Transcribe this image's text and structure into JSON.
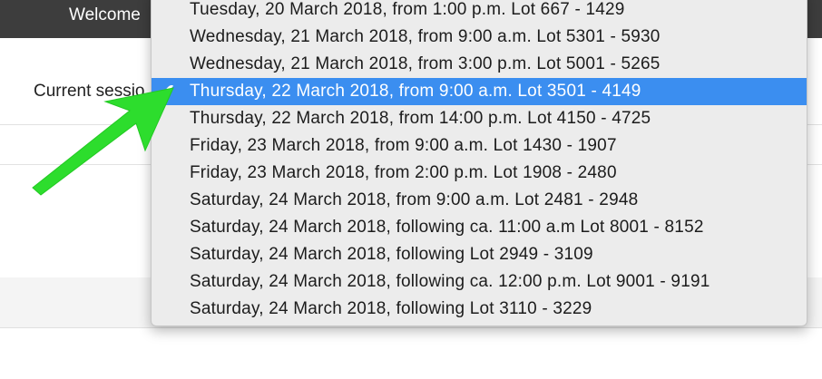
{
  "header": {
    "welcome_text": "Welcome"
  },
  "form": {
    "session_label": "Current sessio"
  },
  "dropdown": {
    "options": [
      {
        "label": "Tuesday, 20 March 2018, from 1:00 p.m. Lot 667 - 1429",
        "selected": false
      },
      {
        "label": "Wednesday, 21 March 2018, from 9:00 a.m. Lot 5301 - 5930",
        "selected": false
      },
      {
        "label": "Wednesday, 21 March 2018, from 3:00 p.m. Lot 5001 - 5265",
        "selected": false
      },
      {
        "label": "Thursday, 22 March 2018, from 9:00 a.m. Lot 3501 - 4149",
        "selected": true
      },
      {
        "label": "Thursday, 22 March 2018, from 14:00 p.m. Lot 4150 - 4725",
        "selected": false
      },
      {
        "label": "Friday, 23 March 2018, from 9:00 a.m. Lot 1430 - 1907",
        "selected": false
      },
      {
        "label": "Friday, 23 March 2018, from 2:00 p.m. Lot 1908 - 2480",
        "selected": false
      },
      {
        "label": "Saturday, 24 March 2018, from 9:00 a.m. Lot 2481 - 2948",
        "selected": false
      },
      {
        "label": "Saturday, 24 March 2018, following ca. 11:00 a.m Lot 8001 - 8152",
        "selected": false
      },
      {
        "label": "Saturday, 24 March 2018, following Lot 2949 - 3109",
        "selected": false
      },
      {
        "label": "Saturday, 24 March 2018, following ca. 12:00 p.m. Lot 9001 - 9191",
        "selected": false
      },
      {
        "label": "Saturday, 24 March 2018, following Lot 3110 - 3229",
        "selected": false
      }
    ],
    "selected_color": "#3b8ef0",
    "check_icon": "checkmark-icon"
  },
  "annotation": {
    "arrow_color": "#2ddd2d",
    "arrow_icon": "green-arrow-icon"
  }
}
